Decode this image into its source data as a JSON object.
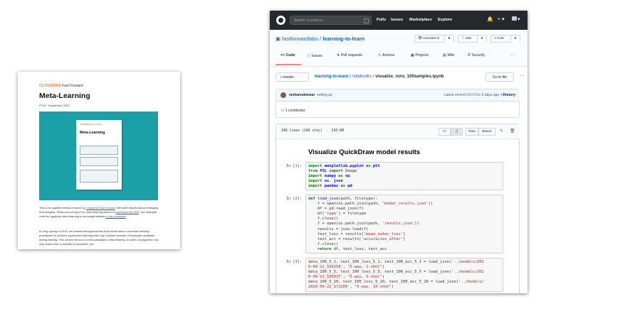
{
  "report": {
    "brand_name": "CLOUDERA",
    "brand_sub": "Fast Forward",
    "title": "Meta-Learning",
    "series": "FF15 · September 2020",
    "thumb_brand": "CLOUDERA Fast Forward",
    "thumb_title": "Meta-Learning",
    "para1_a": "This is an applied research report by ",
    "para1_link1": "Cloudera Fast Forward",
    "para1_b": ". We write reports about emerging technologies. Read our full report on meta-learning below or ",
    "para1_link2": "download the PDF",
    "para1_c": ". Our example code for applying meta-learning to an image dataset ",
    "para1_link3": "is also available",
    "para1_d": ".",
    "para2": "In early spring of 2019, we researched approaches that would allow a machine learning practitioner to perform supervised learning with only a limited number of examples available during training. This search led us to a new paradigm: meta-learning, in which an algorithm not only learns from a handful of examples, but"
  },
  "github": {
    "search_placeholder": "Search or jump to...",
    "search_key": "/",
    "nav": [
      "Pulls",
      "Issues",
      "Marketplace",
      "Explore"
    ],
    "bell_icon": "🔔",
    "plus_label": "+ ▾",
    "user_label": "▾",
    "repo": {
      "owner": "fastforwardlabs",
      "separator": " / ",
      "name": "learning-to-learn",
      "unwatch_label": "👁 Unwatch ▾",
      "unwatch_count": "6",
      "star_label": "☆ Star",
      "star_count": "0",
      "fork_label": "⑂ Fork",
      "fork_count": "0"
    },
    "tabs": [
      {
        "icon": "<>",
        "label": "Code"
      },
      {
        "icon": "ⓘ",
        "label": "Issues"
      },
      {
        "icon": "⇅",
        "label": "Pull requests"
      },
      {
        "icon": "▷",
        "label": "Actions"
      },
      {
        "icon": "▦",
        "label": "Projects"
      },
      {
        "icon": "▤",
        "label": "Wiki"
      },
      {
        "icon": "⛨",
        "label": "Security"
      }
    ],
    "tabs_more": "···",
    "branch": "master ▾",
    "crumbs": {
      "repo": "learning-to-learn",
      "sep1": " / ",
      "folder": "notebooks",
      "sep2": " / ",
      "file": "visualize_runs_100samples.ipynb"
    },
    "goto_file": "Go to file",
    "more_dots": "···",
    "commit": {
      "author": "nishamuktewar",
      "message": "setting up",
      "latest_label": "Latest commit ",
      "sha": "872f19e",
      "time": " 5 days ago",
      "history": "History",
      "contributors": "1 contributor"
    },
    "file": {
      "lines": "249 lines (249 sloc)",
      "size": "243 KB",
      "raw": "Raw",
      "blame": "Blame"
    },
    "notebook": {
      "title": "Visualize QuickDraw model results",
      "prompts": [
        "In [1]:",
        "In [2]:",
        "In [3]:"
      ]
    }
  }
}
